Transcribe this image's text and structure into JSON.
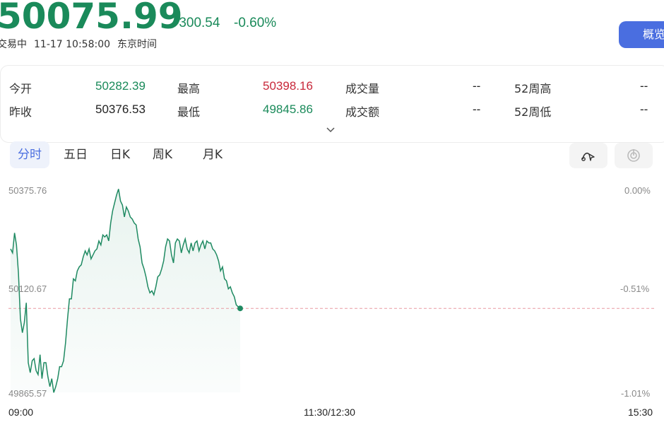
{
  "header": {
    "price": "50075.99",
    "change": "-300.54",
    "change_pct": "-0.60%",
    "status": "交易中",
    "date_time": "11-17 10:58:00",
    "timezone": "东京时间",
    "overview_label": "概览"
  },
  "quote": {
    "open_label": "今开",
    "open": "50282.39",
    "prev_close_label": "昨收",
    "prev_close": "50376.53",
    "high_label": "最高",
    "high": "50398.16",
    "low_label": "最低",
    "low": "49845.86",
    "volume_label": "成交量",
    "volume": "--",
    "turnover_label": "成交额",
    "turnover": "--",
    "w52_high_label": "52周高",
    "w52_high": "--",
    "w52_low_label": "52周低",
    "w52_low": "--"
  },
  "tabs": [
    "分时",
    "五日",
    "日K",
    "周K",
    "月K"
  ],
  "active_tab": "分时",
  "icons": {
    "expand": "chevron-down-icon",
    "draw": "draw-tool-icon",
    "indicator": "indicator-icon"
  },
  "colors": {
    "up": "#c8283a",
    "down": "#1a8a5a",
    "accent": "#4a6ee0",
    "line": "#1f8a62",
    "prev_close_line": "#e89aa2"
  },
  "chart_data": {
    "type": "line",
    "y_left_ticks": [
      "50375.76",
      "50120.67",
      "49865.57"
    ],
    "y_right_ticks": [
      "0.00%",
      "-0.51%",
      "-1.01%"
    ],
    "x_ticks": [
      "09:00",
      "11:30/12:30",
      "15:30"
    ],
    "ylim": [
      49865.57,
      50375.76
    ],
    "prev_close": 50075.99,
    "series": [
      {
        "values": [
          50225,
          50215,
          50265,
          50235,
          50165,
          50050,
          50015,
          50040,
          50090,
          49940,
          49915,
          49945,
          49950,
          49920,
          49910,
          49960,
          49900,
          49940,
          49940,
          49905,
          49880,
          49900,
          49865,
          49880,
          49900,
          49930,
          49930,
          49945,
          49990,
          50050,
          50100,
          50100,
          50150,
          50145,
          50170,
          50180,
          50185,
          50205,
          50220,
          50210,
          50225,
          50200,
          50210,
          50220,
          50225,
          50245,
          50235,
          50260,
          50255,
          50260,
          50245,
          50290,
          50320,
          50340,
          50360,
          50375,
          50345,
          50335,
          50305,
          50330,
          50320,
          50305,
          50300,
          50290,
          50285,
          50250,
          50230,
          50190,
          50175,
          50155,
          50130,
          50115,
          50120,
          50110,
          50130,
          50155,
          50160,
          50175,
          50195,
          50230,
          50250,
          50245,
          50210,
          50190,
          50240,
          50250,
          50245,
          50215,
          50235,
          50250,
          50225,
          50215,
          50240,
          50220,
          50240,
          50245,
          50220,
          50235,
          50245,
          50225,
          50245,
          50240,
          50240,
          50225,
          50220,
          50210,
          50195,
          50170,
          50180,
          50150,
          50145,
          50125,
          50130,
          50115,
          50105,
          50085,
          50080,
          50075.99
        ]
      }
    ]
  }
}
